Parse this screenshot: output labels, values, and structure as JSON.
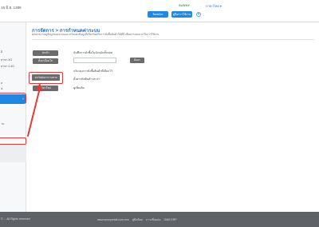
{
  "topbar": {
    "date": "15 มิ.ย. 1386",
    "sale_text": "SUNNY",
    "user_text": "ภาษาไทย ▾",
    "btn_register": "ลิดสมัคร",
    "btn_manual": "คู่มือการใช้งาน",
    "user_icon": "user-circle-icon"
  },
  "sidebar": {
    "items": [
      {
        "label": "อิ"
      },
      {
        "label": "สาขา 3G"
      },
      {
        "label": "สาขา 2.4G"
      },
      {
        "label": "ล"
      },
      {
        "label": "ข"
      }
    ],
    "active_chevron": "˅",
    "sub_text": "าน"
  },
  "content": {
    "title": "การจัดการ > การกำหนดค่าระบบ",
    "subtitle": "คุณสามารถดูข้อมูลของระบบและปรับแต่งข้อมูลที่เกี่ยวข้องกับการสั่งซื้อสินค้าได้ที่นี่ เพื่อความสะดวกในการใช้งาน",
    "buttons": [
      {
        "label": "นำเข้า"
      },
      {
        "label": "ตั้งค่าเงื่อนไข"
      },
      {
        "label": "ค่าเริ่มต้นการวางขาย"
      },
      {
        "label": "ตั้งค่าใหม่"
      }
    ],
    "fields": {
      "label_import": "บันทึกการสั่งซื้อในปัจจุบันทั้งหมด",
      "input_value": "",
      "search_label": "ค้นหา",
      "label_sort": "ปรับปรุงการสั่งซื้อสินค้าที่เลือกไว้",
      "label_display": "ตั้งค่ารหัสสินค้าประจำ",
      "label_time": "ดูเพิ่มเติม"
    }
  },
  "footer": {
    "copyright": "© ... All Rights reserved",
    "links": [
      "www.sunnyretail.com.mm",
      "คู่มือนิยม",
      "การเชื่อมต่อ",
      "OMS ERP"
    ]
  },
  "colors": {
    "accent": "#1e88e5",
    "highlight": "#e53935",
    "button_dark": "#6b6b6b"
  }
}
